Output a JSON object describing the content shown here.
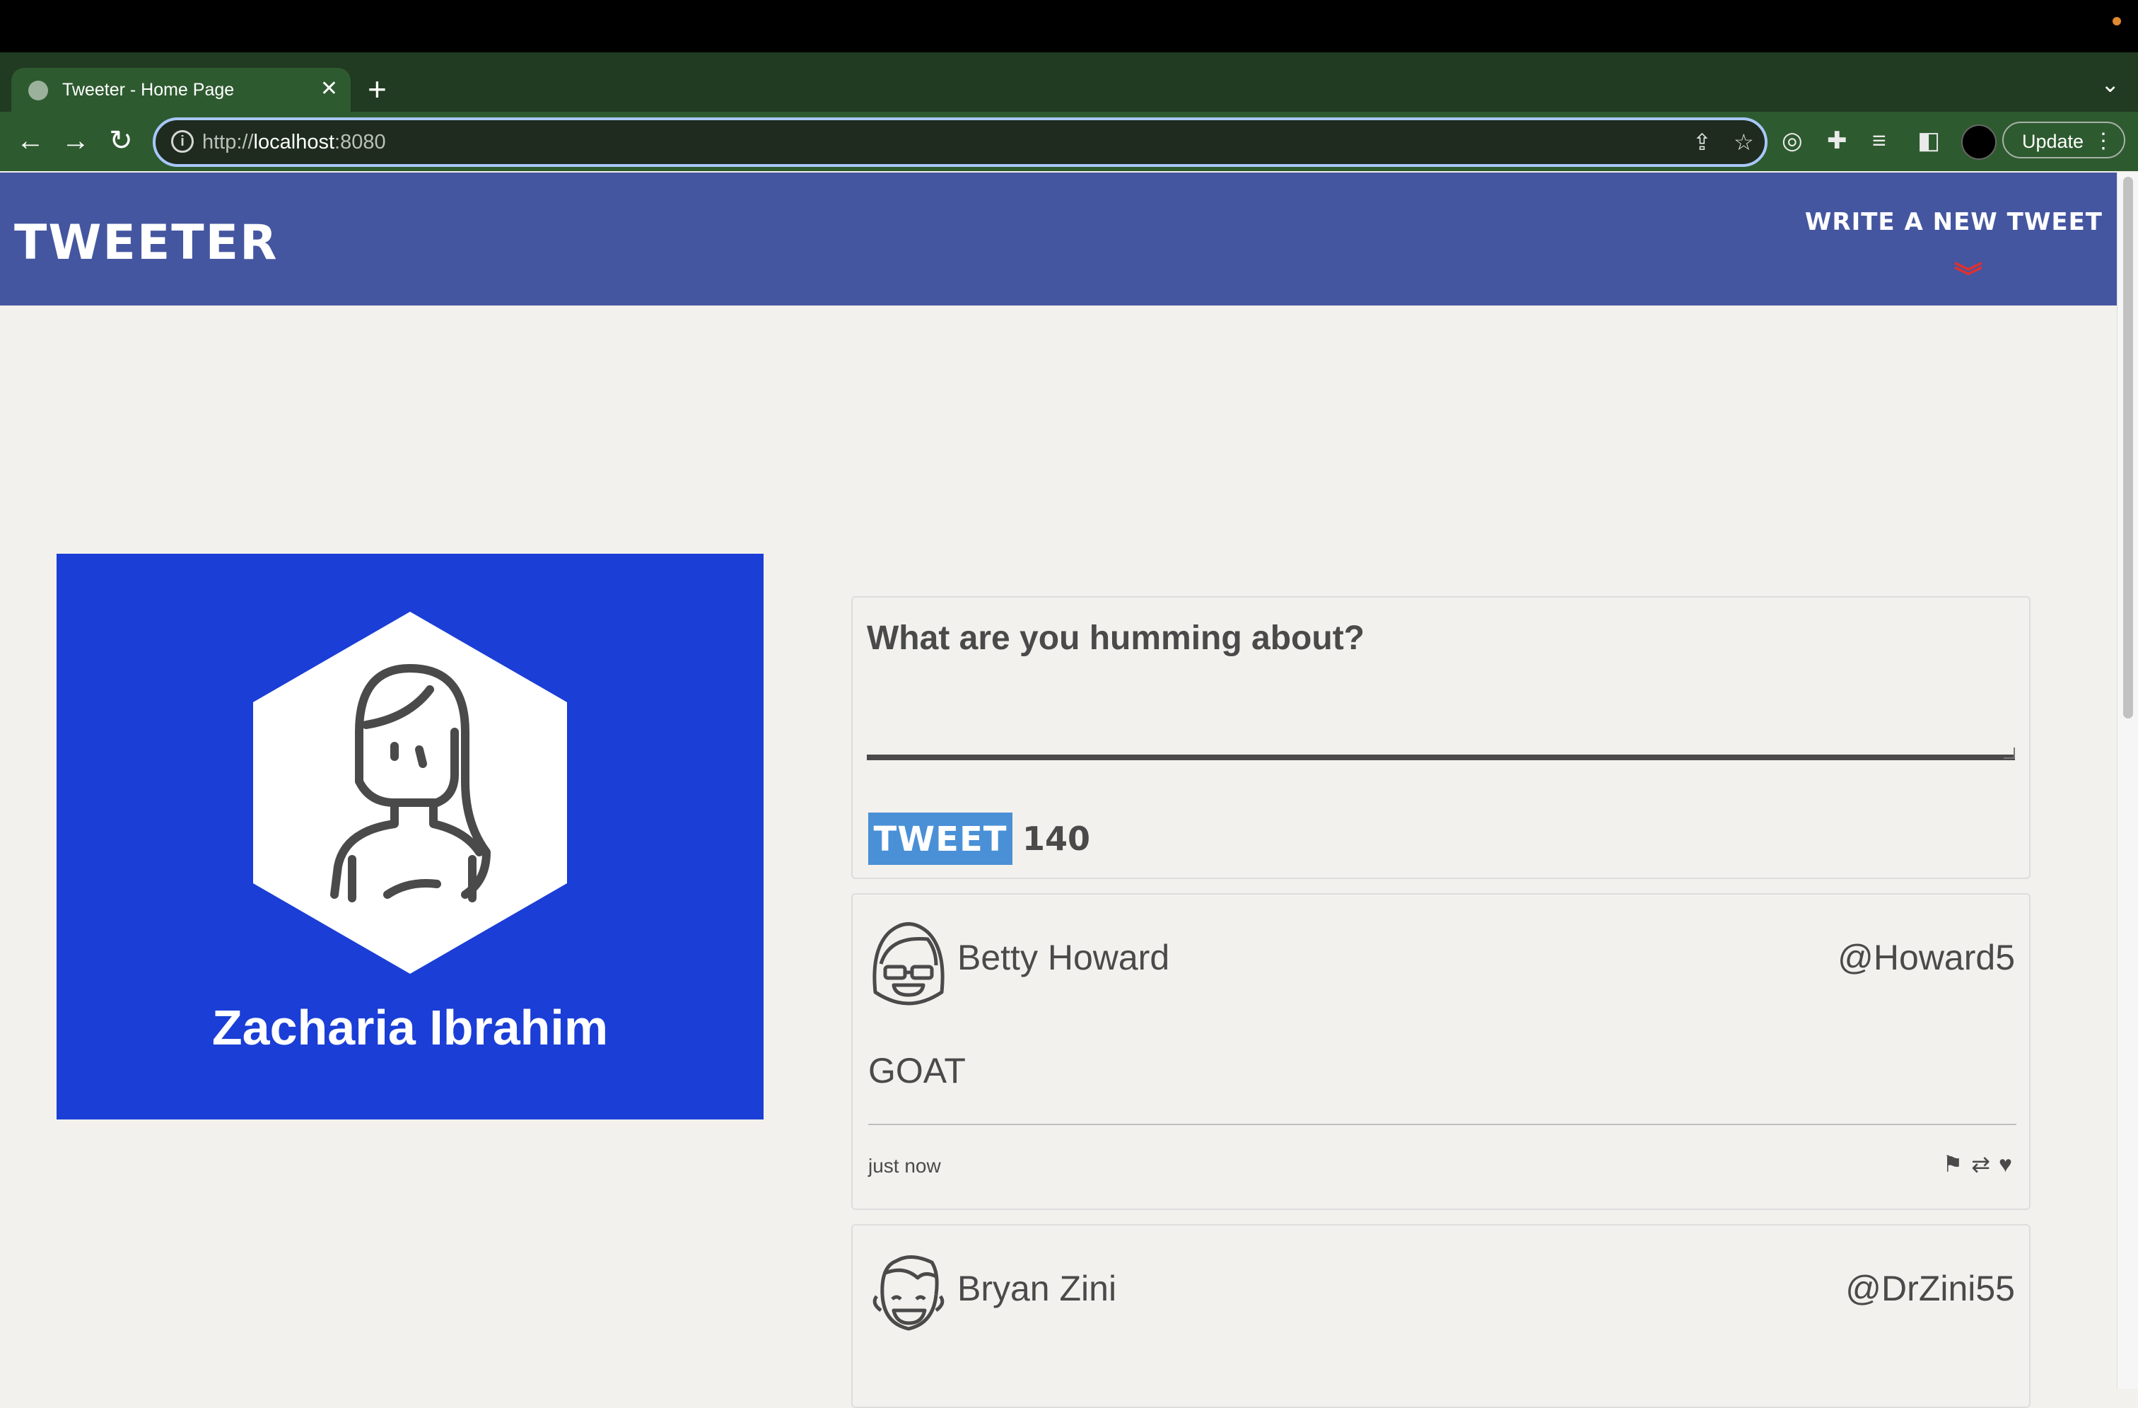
{
  "browser": {
    "tab_title": "Tweeter - Home Page",
    "tab_close": "✕",
    "new_tab": "+",
    "tab_menu": "⌄",
    "url_scheme": "http://",
    "url_host": "localhost",
    "url_port": ":8080",
    "update_label": "Update"
  },
  "nav": {
    "brand": "TWEETER",
    "compose_link": "WRITE A NEW TWEET"
  },
  "profile": {
    "name": "Zacharia Ibrahim",
    "color": "#1a3ed6"
  },
  "composer": {
    "placeholder": "What are you humming about?",
    "button_label": "TWEET",
    "counter": "140"
  },
  "tweets": [
    {
      "name": "Betty Howard",
      "handle": "@Howard5",
      "content": "GOAT",
      "time": "just now",
      "actions": [
        "flag-icon",
        "retweet-icon",
        "heart-icon"
      ]
    },
    {
      "name": "Bryan Zini",
      "handle": "@DrZini55"
    }
  ],
  "colors": {
    "nav_bg": "#4556a0",
    "tweet_button": "#4a90d6",
    "page_bg": "#f3f1ed",
    "chevron": "#e0302f"
  }
}
